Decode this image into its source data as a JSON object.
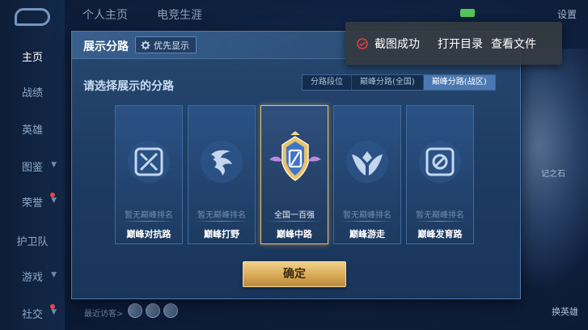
{
  "sidebar": {
    "items": [
      {
        "label": "主页",
        "active": true
      },
      {
        "label": "战绩",
        "active": false
      },
      {
        "label": "英雄",
        "active": false
      },
      {
        "label": "图鉴",
        "active": false
      },
      {
        "label": "荣誉",
        "active": false
      },
      {
        "label": "护卫队",
        "active": false
      },
      {
        "label": "游戏",
        "active": false
      },
      {
        "label": "社交",
        "active": false
      }
    ]
  },
  "topnav": {
    "tabs": [
      "个人主页",
      "电竞生涯"
    ],
    "settings_label": "设置"
  },
  "background": {
    "hero_caption": "记之石",
    "swap_hero_label": "换英雄",
    "recent_visitors_label": "最近访客>"
  },
  "modal": {
    "title": "展示分路",
    "priority_chip_label": "优先显示",
    "subtitle": "请选择展示的分路",
    "tabs": [
      {
        "label": "分路段位",
        "active": false
      },
      {
        "label": "巅峰分路(全国)",
        "active": false
      },
      {
        "label": "巅峰分路(战区)",
        "active": true
      }
    ],
    "cards": [
      {
        "rank": "暂无巅峰排名",
        "lane": "巅峰对抗路",
        "icon": "clash-lane-icon",
        "selected": false
      },
      {
        "rank": "暂无巅峰排名",
        "lane": "巅峰打野",
        "icon": "jungle-icon",
        "selected": false
      },
      {
        "rank": "全国一百强",
        "lane": "巅峰中路",
        "icon": "mid-lane-emblem-icon",
        "selected": true
      },
      {
        "rank": "暂无巅峰排名",
        "lane": "巅峰游走",
        "icon": "roam-icon",
        "selected": false
      },
      {
        "rank": "暂无巅峰排名",
        "lane": "巅峰发育路",
        "icon": "farm-lane-icon",
        "selected": false
      }
    ],
    "confirm_label": "确定"
  },
  "toast": {
    "status": "截图成功",
    "open_dir": "打开目录",
    "view_file": "查看文件"
  },
  "colors": {
    "accent_gold": "#d8aa55",
    "selected_border": "#e8c26a",
    "active_tab": "#4a78b0",
    "success_red": "#e0403c"
  }
}
